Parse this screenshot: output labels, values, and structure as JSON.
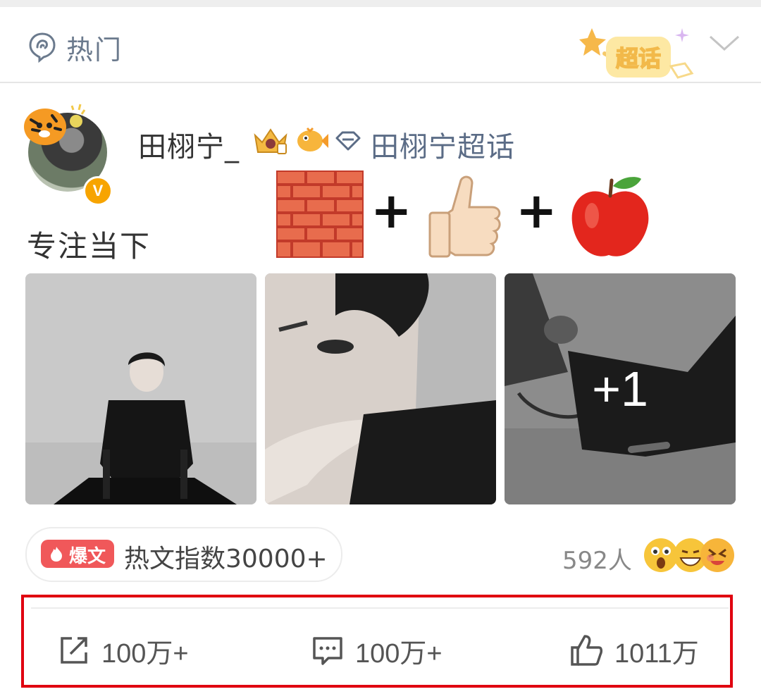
{
  "header": {
    "section_label": "热门",
    "badge_label": "超话"
  },
  "post": {
    "username": "田栩宁_",
    "topic_link": "田栩宁超话",
    "verified_badge": "V",
    "text": "专注当下",
    "emoji_sequence": [
      "brick-emoji",
      "+",
      "thumbs-up-emoji",
      "+",
      "red-apple-emoji"
    ],
    "images": {
      "more_count": "+1"
    }
  },
  "engagement": {
    "hot_tag": "爆文",
    "hot_index": "热文指数30000+",
    "reaction_count": "592人"
  },
  "actions": {
    "repost_count": "100万+",
    "comment_count": "100万+",
    "like_count": "1011万"
  },
  "colors": {
    "link": "#5b6c86",
    "hot_tag": "#f0585a",
    "highlight_box": "#e0000f",
    "verified": "#f7a400"
  }
}
